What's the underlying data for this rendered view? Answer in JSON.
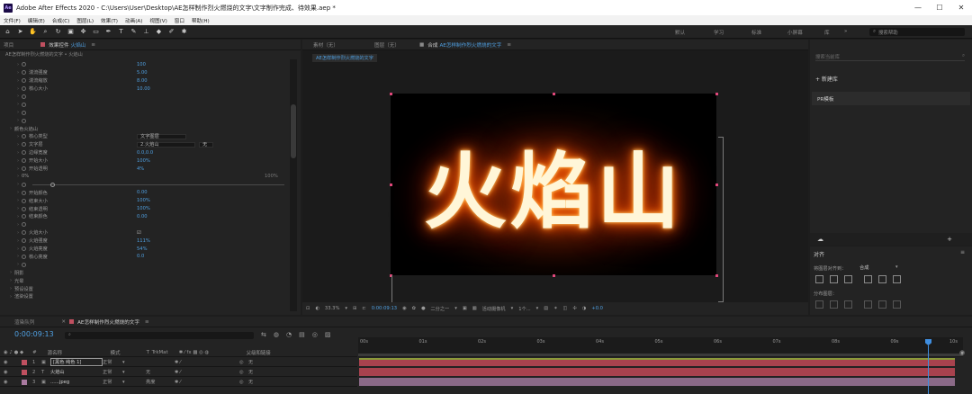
{
  "app": {
    "logo": "Ae",
    "title": "Adobe After Effects 2020 - C:\\Users\\User\\Desktop\\AE怎样制作烈火燃烧的文字\\文字制作完成、待效果.aep *",
    "window_controls": [
      "—",
      "☐",
      "✕"
    ]
  },
  "menu": [
    "文件(F)",
    "编辑(E)",
    "合成(C)",
    "图层(L)",
    "效果(T)",
    "动画(A)",
    "视图(V)",
    "窗口",
    "帮助(H)"
  ],
  "toolbar": {
    "workspaces": [
      "默认",
      "学习",
      "标准",
      "小屏幕",
      "库"
    ],
    "search_placeholder": "搜索帮助"
  },
  "effects_panel": {
    "tab_project": "项目",
    "tab_effects": "效果控件",
    "layer_name": "火焰山",
    "breadcrumb": "AE怎样制作烈火燃烧的文字 • 火焰山",
    "rows": [
      {
        "label": "",
        "value": "100"
      },
      {
        "label": "湍流强度",
        "value": "5.00"
      },
      {
        "label": "湍流缩放",
        "value": "8.00"
      },
      {
        "label": "核心大小",
        "value": "10.00"
      },
      {
        "label": "",
        "value": ""
      },
      {
        "label": "",
        "value": ""
      },
      {
        "label": "",
        "value": ""
      },
      {
        "label": "",
        "value": ""
      },
      {
        "label": "颜色火焰山",
        "value": ""
      },
      {
        "label": "核心类型",
        "value": "文字图层"
      },
      {
        "label": "文字层",
        "value": "2.火焰山"
      },
      {
        "label": "边缘宽度",
        "value": "0.0,0.0"
      },
      {
        "label": "开始大小",
        "value": "100%"
      },
      {
        "label": "开始透明",
        "value": "4%"
      },
      {
        "label": "0%",
        "value": "100%"
      },
      {
        "label": "",
        "value": ""
      },
      {
        "label": "开始颜色",
        "value": "0.00"
      },
      {
        "label": "结束大小",
        "value": "100%"
      },
      {
        "label": "结束透明",
        "value": "100%"
      },
      {
        "label": "结束颜色",
        "value": "0.00"
      },
      {
        "label": "",
        "value": ""
      },
      {
        "label": "火焰大小",
        "value": ""
      },
      {
        "label": "火焰强度",
        "value": "111%"
      },
      {
        "label": "火焰亮度",
        "value": "54%"
      },
      {
        "label": "核心亮度",
        "value": "0.0"
      },
      {
        "label": "",
        "value": ""
      },
      {
        "label": "阴影",
        "value": ""
      },
      {
        "label": "光晕",
        "value": ""
      },
      {
        "label": "预设设置",
        "value": ""
      },
      {
        "label": "渲染设置",
        "value": ""
      }
    ],
    "dropdown_sep": "无",
    "checkbox": "☑"
  },
  "viewer": {
    "tab_footage": "素材（无）",
    "tab_layer": "图层（无）",
    "tab_comp_prefix": "合成",
    "comp_name": "AE怎样制作烈火燃烧的文字",
    "comp_sub_tab": "AE怎样制作烈火燃烧的文字",
    "fire_text": "火焰山",
    "zoom": "33.3%",
    "timecode": "0:00:09:13",
    "resolution": "二分之一",
    "camera": "活动摄像机",
    "views": "1个...",
    "exposure": "+0.0"
  },
  "library_panel": {
    "search_placeholder": "搜索当前库",
    "new_library": "+ 新建库",
    "library_item": "PR模板"
  },
  "align_panel": {
    "title": "对齐",
    "align_to_label": "将图层对齐到：",
    "align_to_value": "合成",
    "distribute_label": "分布图层："
  },
  "timeline": {
    "tab_render": "渲染队列",
    "comp_tab": "AE怎样制作烈火燃烧的文字",
    "timecode": "0:00:09:13",
    "columns": [
      "源名称",
      "模式",
      "T",
      "TrkMat",
      "父级和链接"
    ],
    "layers": [
      {
        "num": "1",
        "name": "[黑色 纯色 1]",
        "mode": "正常",
        "trkmat": "",
        "parent": "无",
        "color": "#c05060"
      },
      {
        "num": "2",
        "name": "火焰山",
        "mode": "正常",
        "trkmat": "无",
        "parent": "无",
        "color": "#c05060"
      },
      {
        "num": "3",
        "name": "......jpeg",
        "mode": "正常",
        "trkmat": "亮度",
        "parent": "无",
        "color": "#a97aa0"
      }
    ],
    "ruler": [
      "00s",
      "01s",
      "02s",
      "03s",
      "04s",
      "05s",
      "06s",
      "07s",
      "08s",
      "09s",
      "10s"
    ]
  }
}
